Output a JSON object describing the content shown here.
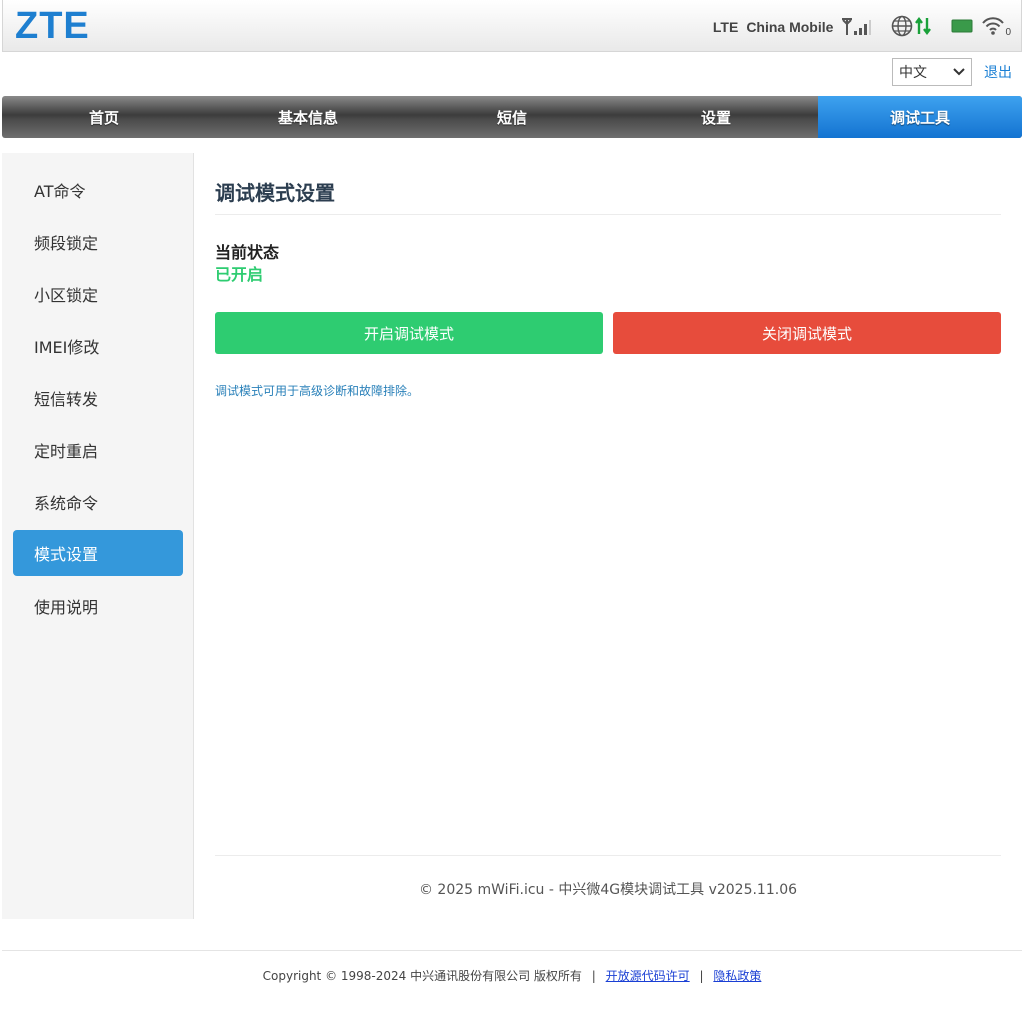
{
  "header": {
    "logo": "ZTE",
    "network_type": "LTE",
    "carrier": "China Mobile",
    "signal_icon": "signal-bars-icon",
    "globe_icon": "globe-icon",
    "transfer_icon": "data-transfer-icon",
    "sim_icon": "sim-card-icon",
    "wifi_icon": "wifi-icon",
    "wifi_clients": "0"
  },
  "lang": {
    "selected": "中文",
    "logout": "退出"
  },
  "nav": {
    "items": [
      {
        "label": "首页"
      },
      {
        "label": "基本信息"
      },
      {
        "label": "短信"
      },
      {
        "label": "设置"
      },
      {
        "label": "调试工具"
      }
    ],
    "active_index": 4
  },
  "sidebar": {
    "items": [
      {
        "label": "AT命令"
      },
      {
        "label": "频段锁定"
      },
      {
        "label": "小区锁定"
      },
      {
        "label": "IMEI修改"
      },
      {
        "label": "短信转发"
      },
      {
        "label": "定时重启"
      },
      {
        "label": "系统命令"
      },
      {
        "label": "模式设置"
      },
      {
        "label": "使用说明"
      }
    ],
    "active_index": 7
  },
  "main": {
    "title": "调试模式设置",
    "state_label": "当前状态",
    "state_value": "已开启",
    "enable_button": "开启调试模式",
    "disable_button": "关闭调试模式",
    "hint": "调试模式可用于高级诊断和故障排除。",
    "footer": "© 2025 mWiFi.icu - 中兴微4G模块调试工具 v2025.11.06"
  },
  "footer": {
    "copyright": "Copyright © 1998-2024 中兴通讯股份有限公司 版权所有",
    "sep": "|",
    "link_open_source": "开放源代码许可",
    "link_privacy": "隐私政策"
  },
  "colors": {
    "brand": "#1e7fd0",
    "nav_active": "#1a7fd4",
    "sidebar_active": "#3498db",
    "success": "#2ecc71",
    "danger": "#e74c3c",
    "hint": "#2980b9"
  }
}
